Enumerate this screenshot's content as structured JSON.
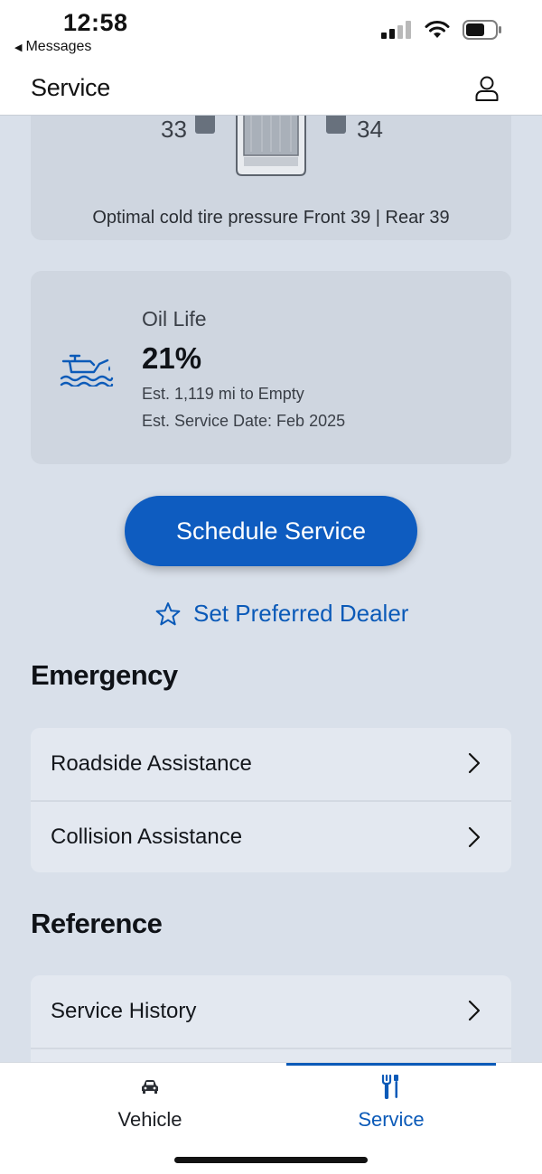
{
  "status_bar": {
    "time": "12:58",
    "back_label": "Messages"
  },
  "header": {
    "title": "Service",
    "profile_icon": "person-icon"
  },
  "tire_card": {
    "front_left": "33",
    "front_right": "34",
    "caption": "Optimal cold tire pressure Front 39 | Rear 39"
  },
  "oil_card": {
    "icon": "oil-can-icon",
    "label": "Oil Life",
    "value": "21%",
    "distance": "Est. 1,119 mi to Empty",
    "service_date": "Est. Service Date: Feb 2025"
  },
  "actions": {
    "schedule_label": "Schedule Service",
    "dealer_label": "Set Preferred Dealer"
  },
  "emergency": {
    "title": "Emergency",
    "items": [
      {
        "label": "Roadside Assistance"
      },
      {
        "label": "Collision Assistance"
      }
    ]
  },
  "reference": {
    "title": "Reference",
    "items": [
      {
        "label": "Service History"
      }
    ]
  },
  "bottom_nav": {
    "tabs": [
      {
        "label": "Vehicle",
        "icon": "car-icon",
        "active": false
      },
      {
        "label": "Service",
        "icon": "tools-icon",
        "active": true
      }
    ]
  },
  "colors": {
    "accent": "#0e5cc0",
    "link": "#0b5ab8",
    "background": "#d9e0ea",
    "card": "#cfd6e0"
  }
}
